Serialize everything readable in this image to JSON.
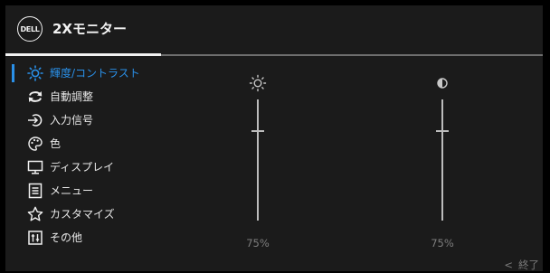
{
  "header": {
    "logo_text": "DELL",
    "title": "2Xモニター"
  },
  "menu": {
    "items": [
      {
        "label": "輝度/コントラスト",
        "icon": "brightness-icon",
        "active": true
      },
      {
        "label": "自動調整",
        "icon": "auto-adjust-icon",
        "active": false
      },
      {
        "label": "入力信号",
        "icon": "input-source-icon",
        "active": false
      },
      {
        "label": "色",
        "icon": "color-palette-icon",
        "active": false
      },
      {
        "label": "ディスプレイ",
        "icon": "display-monitor-icon",
        "active": false
      },
      {
        "label": "メニュー",
        "icon": "menu-list-icon",
        "active": false
      },
      {
        "label": "カスタマイズ",
        "icon": "star-icon",
        "active": false
      },
      {
        "label": "その他",
        "icon": "other-settings-icon",
        "active": false
      }
    ]
  },
  "sliders": {
    "brightness": {
      "icon": "brightness-icon",
      "value": "75%",
      "level": 0.75
    },
    "contrast": {
      "icon": "contrast-icon",
      "value": "75%",
      "level": 0.75
    }
  },
  "footer": {
    "exit_chevron": "<",
    "exit_label": "終了"
  },
  "colors": {
    "accent": "#2a90e8",
    "panel_background": "#1b1b1b",
    "text": "#e8e8e8",
    "muted_text": "#7e7e7e"
  }
}
